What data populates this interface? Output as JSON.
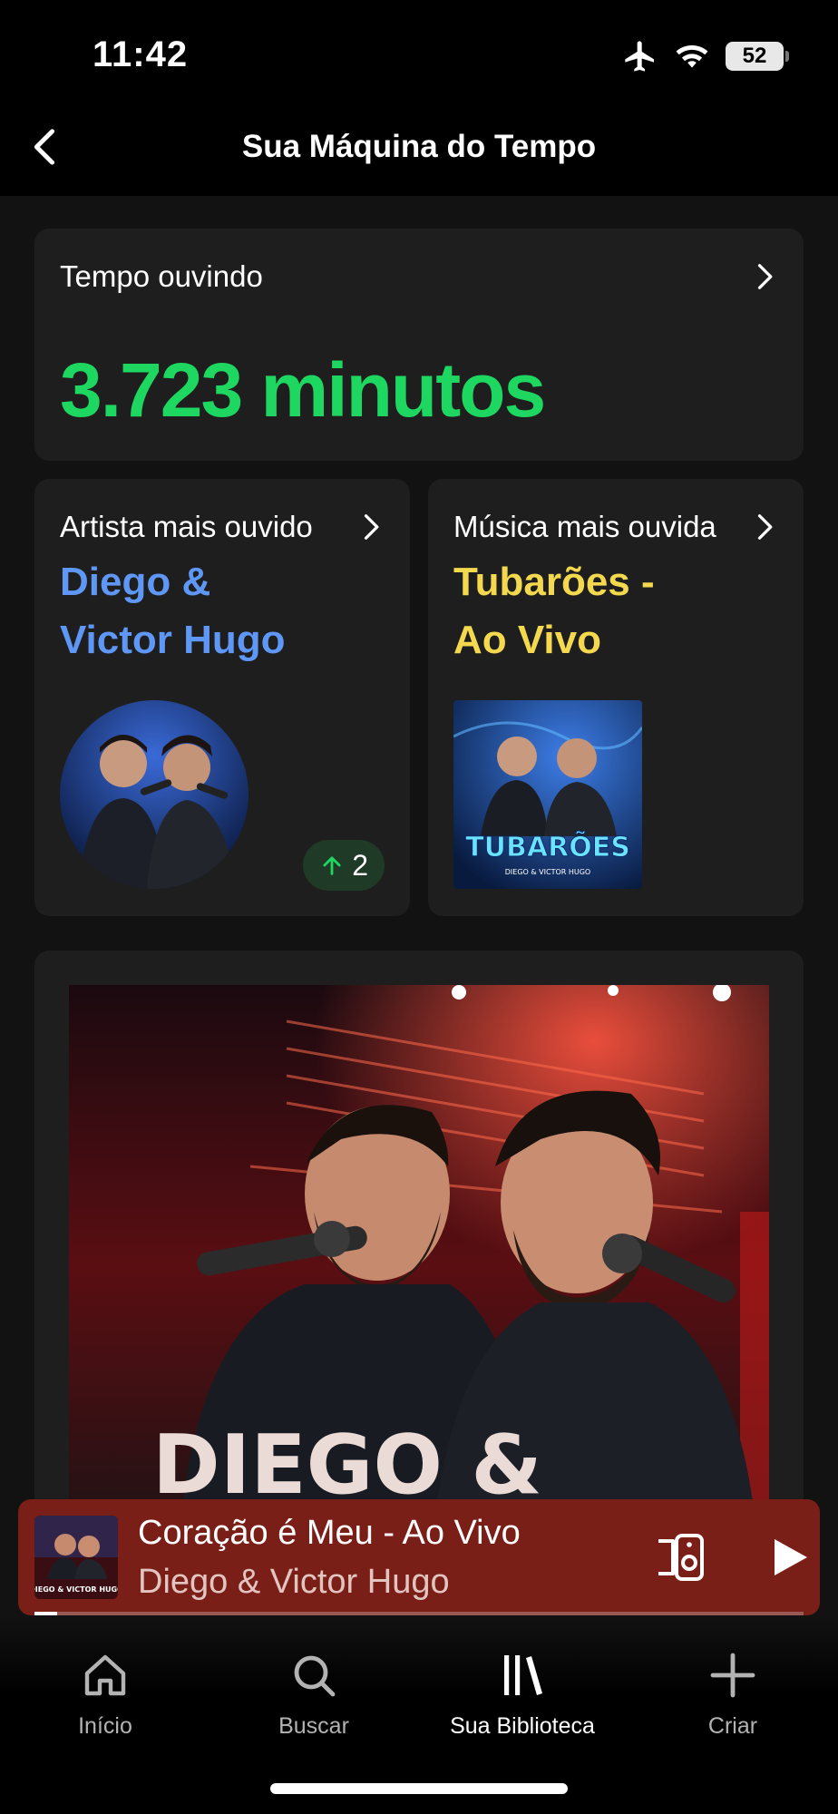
{
  "status": {
    "time": "11:42",
    "battery": "52"
  },
  "header": {
    "title": "Sua Máquina do Tempo"
  },
  "listening_time": {
    "label": "Tempo ouvindo",
    "value": "3.723 minutos"
  },
  "top_artist": {
    "label": "Artista mais ouvido",
    "name_line1": "Diego &",
    "name_line2": "Victor Hugo",
    "rank_change": "2",
    "color": "#5e97f6"
  },
  "top_track": {
    "label": "Música mais ouvida",
    "name_line1": "Tubarões -",
    "name_line2": "Ao Vivo",
    "cover_text": "TUBARÕES",
    "cover_subtext": "DIEGO & VICTOR HUGO",
    "color": "#f4d94e"
  },
  "album": {
    "art_text": "DIEGO &"
  },
  "now_playing": {
    "title": "Coração é Meu - Ao Vivo",
    "artist": "Diego & Victor Hugo",
    "cover_text": "DIEGO & VICTOR HUGO",
    "progress": 0.03
  },
  "tabs": [
    {
      "label": "Início",
      "icon": "home-icon"
    },
    {
      "label": "Buscar",
      "icon": "search-icon"
    },
    {
      "label": "Sua Biblioteca",
      "icon": "library-icon",
      "active": true
    },
    {
      "label": "Criar",
      "icon": "plus-icon"
    }
  ],
  "accent": "#1ed760"
}
